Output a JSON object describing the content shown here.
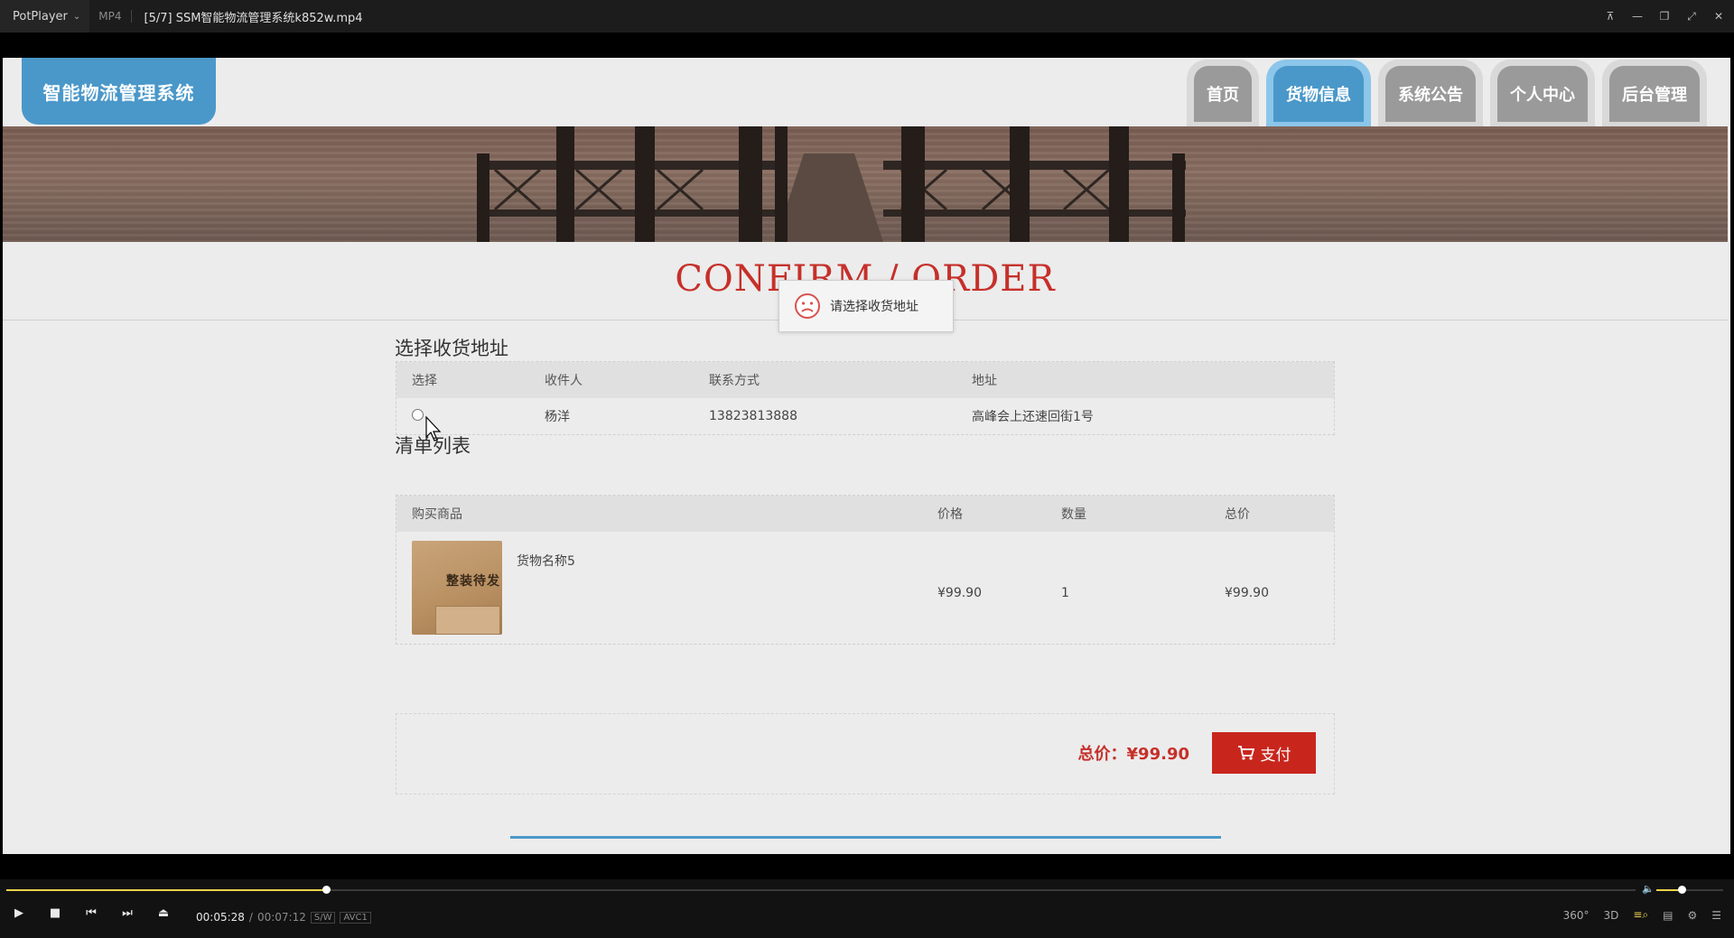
{
  "player": {
    "app_name": "PotPlayer",
    "format": "MP4",
    "file_title": "[5/7] SSM智能物流管理系统k852w.mp4",
    "current_time": "00:05:28",
    "separator": "/",
    "total_time": "00:07:12",
    "tag_sw": "S/W",
    "tag_codec": "AVC1",
    "progress": 0.196,
    "volume": 0.38,
    "right_icons": [
      "360°",
      "3D"
    ]
  },
  "site": {
    "logo": "智能物流管理系统",
    "nav": [
      {
        "label": "首页",
        "active": false
      },
      {
        "label": "货物信息",
        "active": true
      },
      {
        "label": "系统公告",
        "active": false
      },
      {
        "label": "个人中心",
        "active": false
      },
      {
        "label": "后台管理",
        "active": false
      }
    ],
    "heading": "CONFIRM / ORDER",
    "toast": "请选择收货地址"
  },
  "address": {
    "title": "选择收货地址",
    "headers": [
      "选择",
      "收件人",
      "联系方式",
      "地址"
    ],
    "rows": [
      {
        "name": "杨洋",
        "phone": "13823813888",
        "addr": "高峰会上还速回街1号"
      }
    ]
  },
  "order": {
    "title": "清单列表",
    "headers": [
      "购买商品",
      "价格",
      "数量",
      "总价"
    ],
    "items": [
      {
        "name": "货物名称5",
        "price": "¥99.90",
        "qty": "1",
        "total": "¥99.90",
        "img_label": "整装待发"
      }
    ]
  },
  "summary": {
    "total": "总价：¥99.90",
    "pay": "支付"
  },
  "colors": {
    "accent": "#4a98c9",
    "danger": "#c8261d",
    "seek": "#e9d24a"
  }
}
